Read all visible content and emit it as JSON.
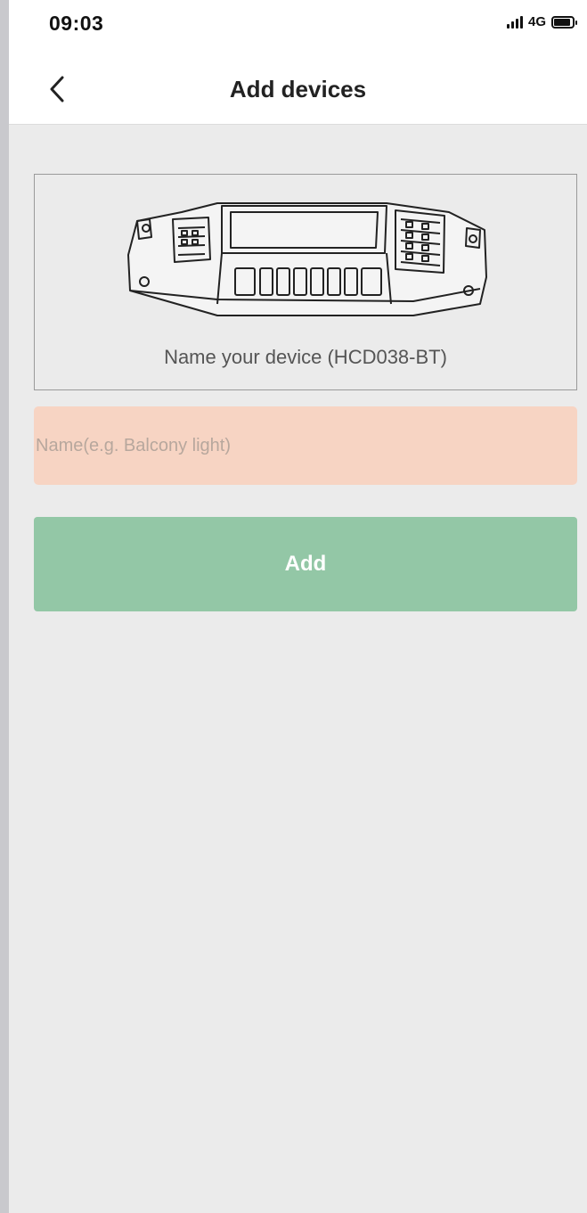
{
  "status_bar": {
    "time": "09:03",
    "network": "4G",
    "icons": [
      "signal-icon",
      "battery-icon"
    ]
  },
  "nav": {
    "back_icon": "chevron-left-icon",
    "title": "Add devices"
  },
  "device": {
    "image_icon": "led-driver-illustration",
    "caption": "Name your device (HCD038-BT)"
  },
  "form": {
    "name_value": "",
    "name_placeholder": "Name(e.g. Balcony light)",
    "add_label": "Add"
  },
  "colors": {
    "input_background": "#f7d4c3",
    "add_button": "#93c7a6",
    "page_background": "#ebebeb"
  }
}
